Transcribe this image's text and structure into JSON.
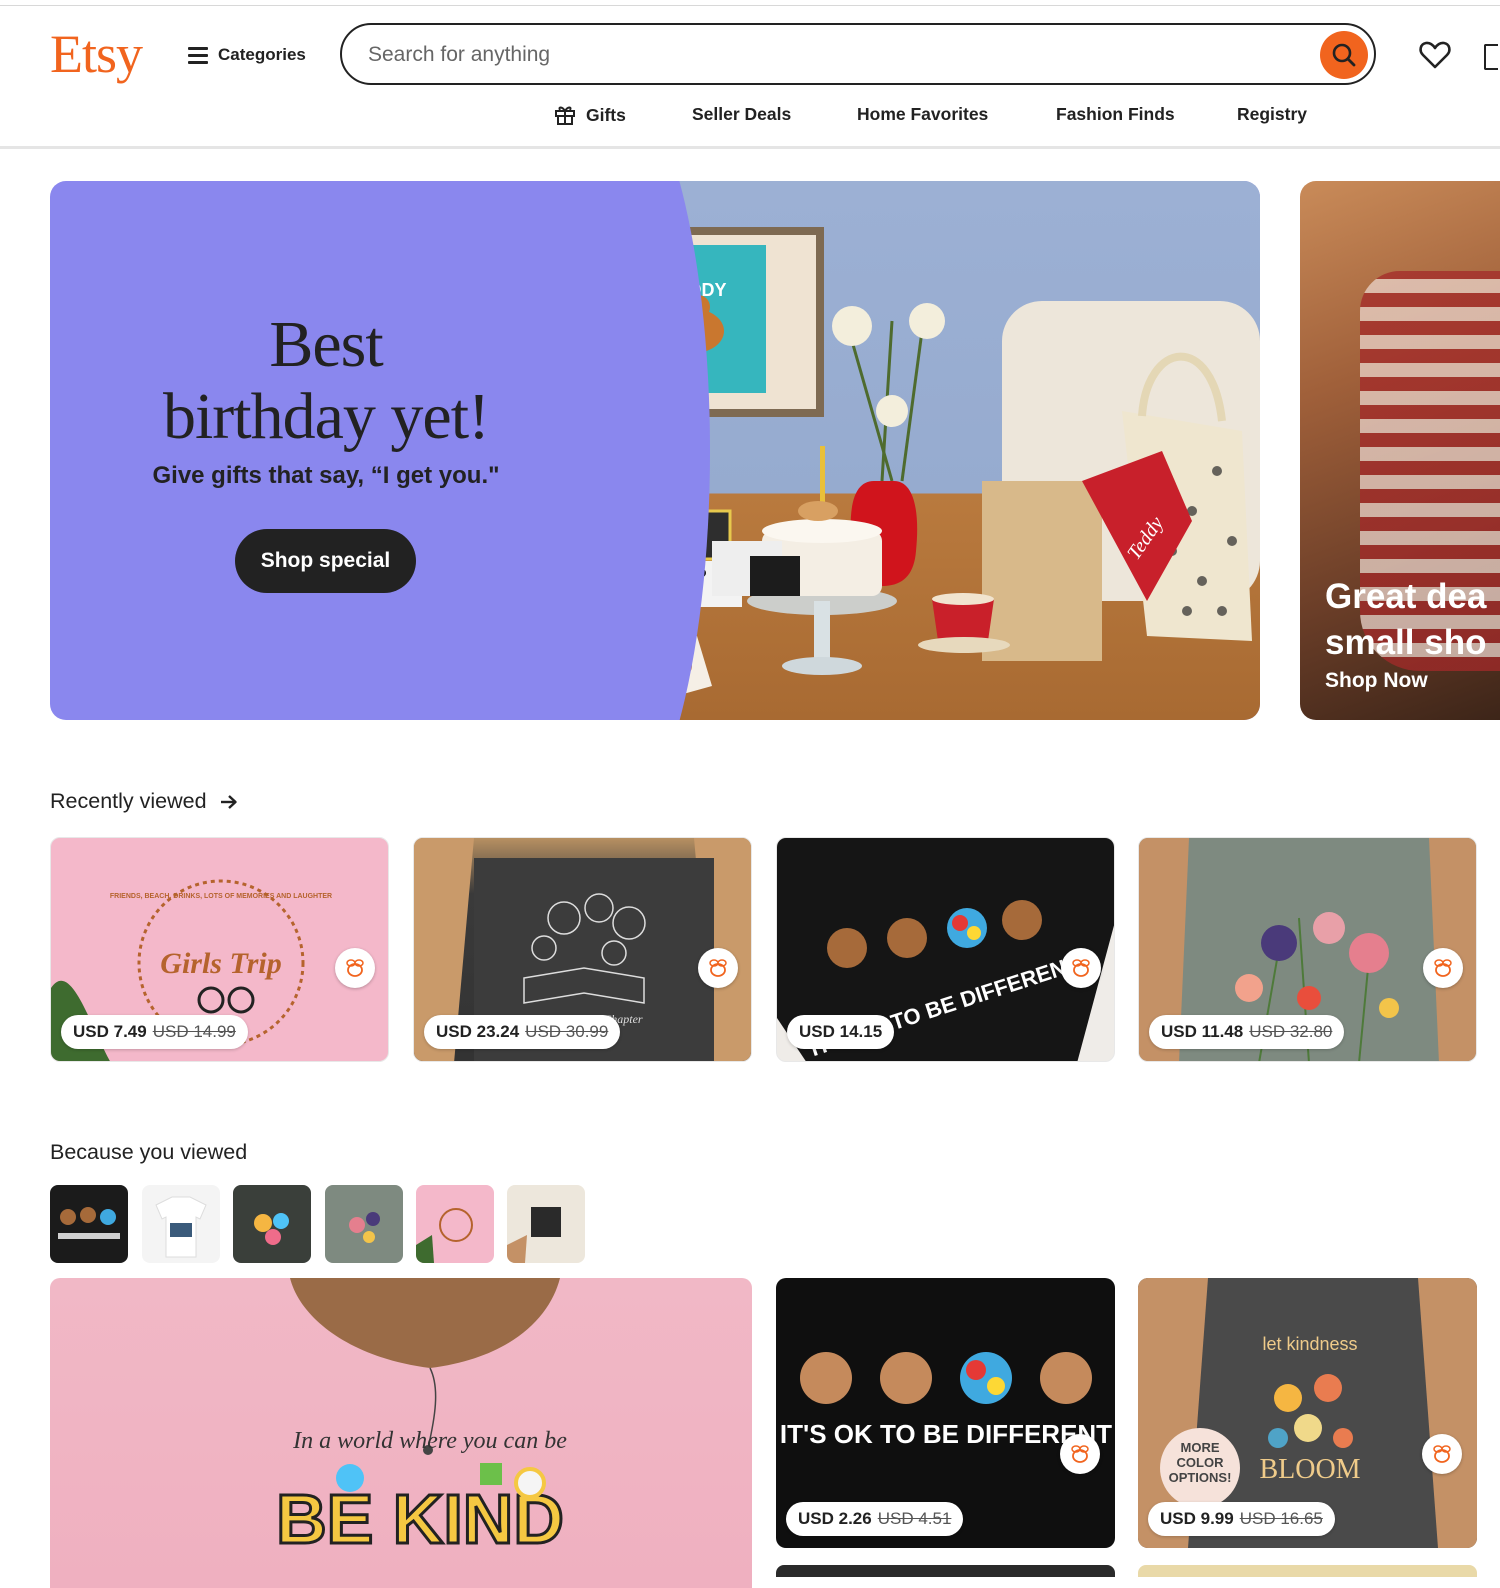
{
  "header": {
    "logo": "Etsy",
    "categories_label": "Categories",
    "search_placeholder": "Search for anything",
    "nav": [
      "Gifts",
      "Seller Deals",
      "Home Favorites",
      "Fashion Finds",
      "Registry"
    ]
  },
  "hero": {
    "title_line1": "Best",
    "title_line2": "birthday yet!",
    "subtitle": "Give gifts that say, “I get you.\"",
    "button": "Shop special",
    "frame_text": "TEDDY",
    "bandana_text": "Teddy"
  },
  "hero2": {
    "title_line1": "Great dea",
    "title_line2": "small sho",
    "link": "Shop Now"
  },
  "recently_viewed": {
    "title": "Recently viewed",
    "items": [
      {
        "price": "USD 7.49",
        "old_price": "USD 14.99",
        "art_text": "Girls Trip",
        "art_ring": "FRIENDS, BEACH, DRINKS, LOTS OF MEMORIES AND LAUGHTER"
      },
      {
        "price": "USD 23.24",
        "old_price": "USD 30.99",
        "art_text": "Just One More Chapter"
      },
      {
        "price": "USD 14.15",
        "old_price": "",
        "art_text": "IT'S OK TO BE DIFFERENT"
      },
      {
        "price": "USD 11.48",
        "old_price": "USD 32.80",
        "art_text": ""
      }
    ]
  },
  "because_viewed": {
    "title": "Because you viewed",
    "big_text_line1": "In a world where you can be",
    "big_text_line2": "BE KIND",
    "items": [
      {
        "price": "USD 2.26",
        "old_price": "USD 4.51",
        "art_text": "IT'S OK TO BE DIFFERENT"
      },
      {
        "price": "USD 9.99",
        "old_price": "USD 16.65",
        "art_text_top": "let kindness",
        "art_text_bottom": "BLOOM",
        "badge": "MORE COLOR OPTIONS!"
      }
    ]
  },
  "colors": {
    "accent": "#F1641E",
    "hero_bg": "#8A87EE",
    "text": "#222222"
  }
}
